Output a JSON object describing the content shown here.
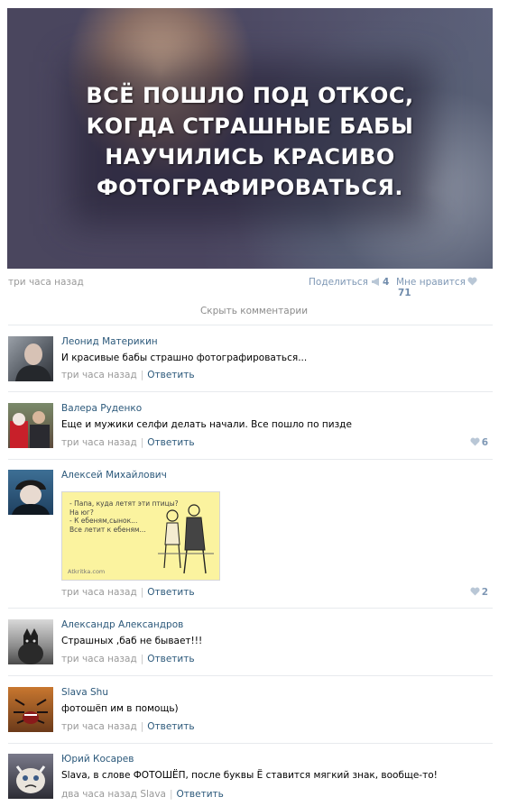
{
  "post": {
    "image_caption": [
      "ВСЁ ПОШЛО ПОД ОТКОС,",
      "КОГДА СТРАШНЫЕ БАБЫ",
      "НАУЧИЛИСЬ КРАСИВО",
      "ФОТОГРАФИРОВАТЬСЯ."
    ],
    "time": "три часа назад",
    "share_label": "Поделиться",
    "share_count": "4",
    "like_label": "Мне нравится",
    "like_count": "71",
    "hide_comments": "Скрыть комментарии"
  },
  "comments": [
    {
      "author": "Леонид Материкин",
      "text": "И красивые бабы страшно фотографироваться...",
      "time": "три часа назад",
      "reply": "Ответить",
      "likes": ""
    },
    {
      "author": "Валера Руденко",
      "text": "Еще и мужики селфи делать начали. Все пошло по пизде",
      "time": "три часа назад",
      "reply": "Ответить",
      "likes": "6"
    },
    {
      "author": "Алексей Михайлович",
      "attachment_text": [
        "- Папа, куда летят эти птицы?",
        "На юг?",
        "- К ебеням,сынок...",
        "   Все летит к ебеням..."
      ],
      "attachment_logo": "Atkritka.com",
      "time": "три часа назад",
      "reply": "Ответить",
      "likes": "2"
    },
    {
      "author": "Александр Александров",
      "text": "Страшных ,баб не бывает!!!",
      "time": "три часа назад",
      "reply": "Ответить",
      "likes": ""
    },
    {
      "author": "Slava Shu",
      "text": "фотошёп им в помощь)",
      "time": "три часа назад",
      "reply": "Ответить",
      "likes": ""
    },
    {
      "author": "Юрий Косарев",
      "text": "Slava, в слове ФОТОШЁП, после буквы Ё ставится мягкий знак, вообще-то!",
      "time": "два часа назад",
      "reply_to": "Slava",
      "reply": "Ответить",
      "likes": ""
    }
  ],
  "colors": {
    "link": "#2b587a",
    "meta": "#999999",
    "like_accent": "#7f98b5",
    "separator": "#e7eaed"
  },
  "icons": [
    "megaphone-icon",
    "heart-icon"
  ]
}
